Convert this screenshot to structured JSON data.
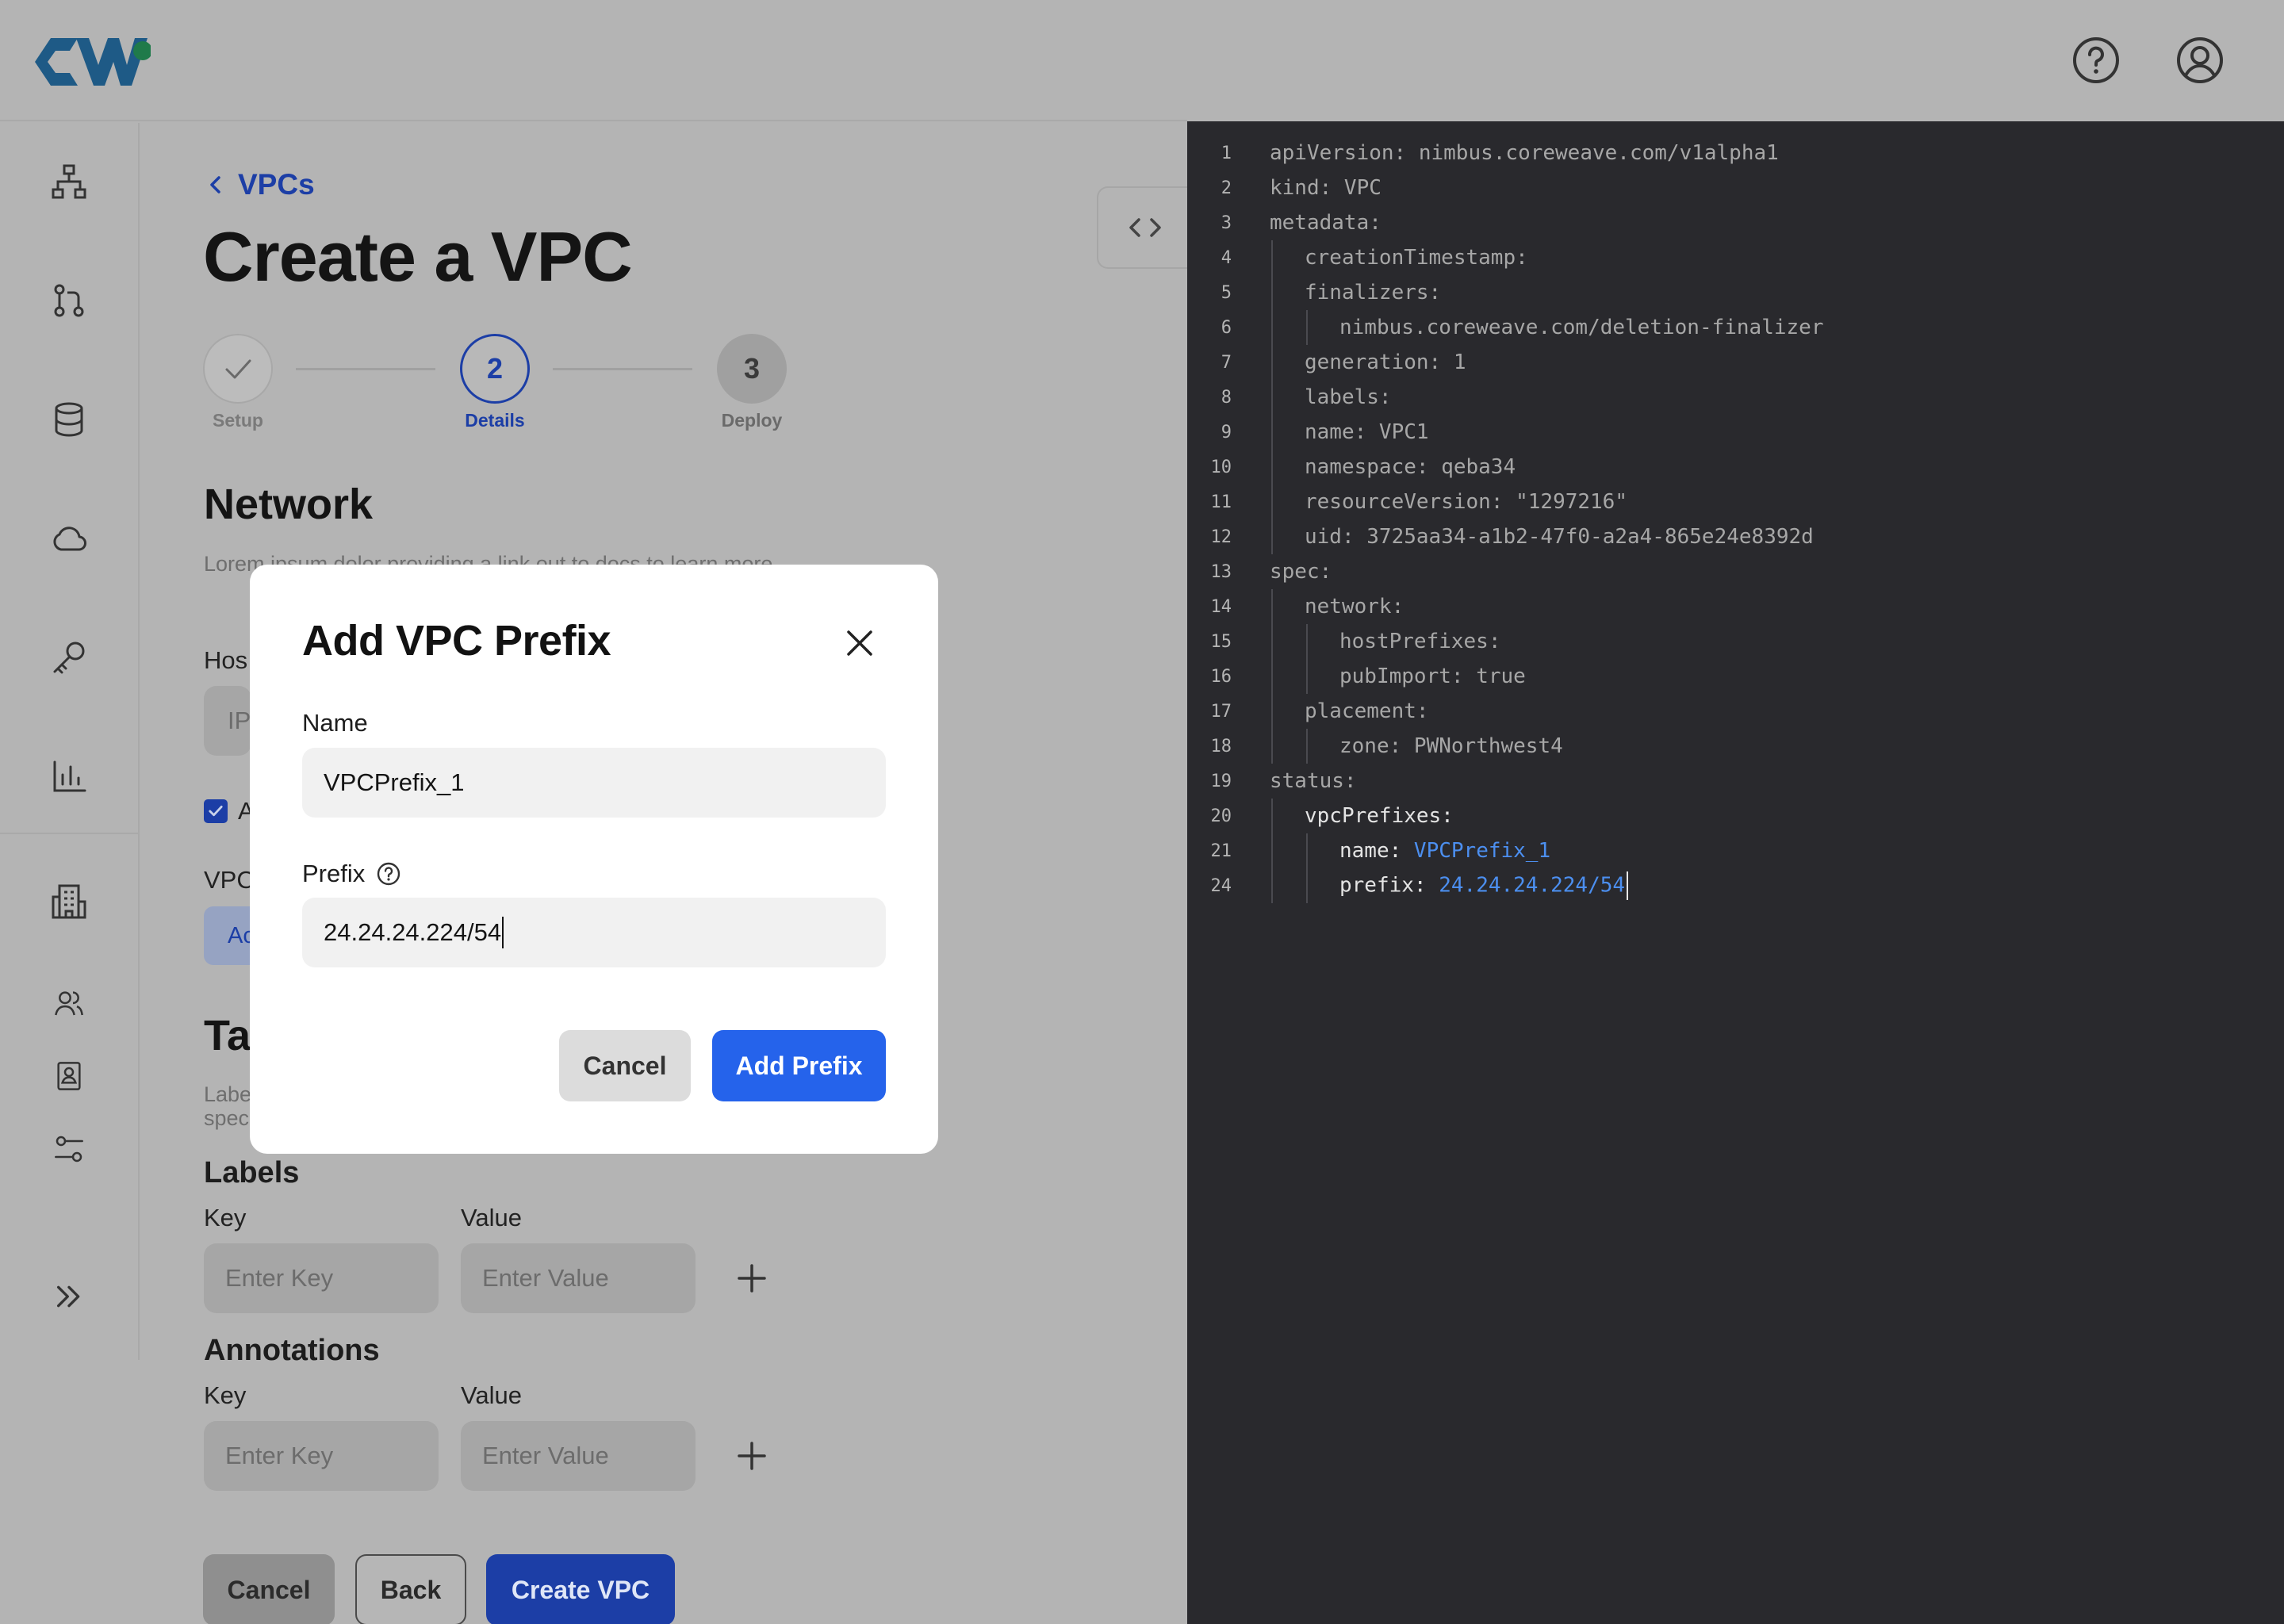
{
  "header": {
    "logo_alt": "CW",
    "help_icon": "help-circle-icon",
    "user_icon": "user-circle-icon"
  },
  "sidebar": {
    "items": [
      {
        "icon": "network-topology-icon"
      },
      {
        "icon": "git-pull-request-icon"
      },
      {
        "icon": "database-icon"
      },
      {
        "icon": "cloud-icon"
      },
      {
        "icon": "key-icon"
      },
      {
        "icon": "bar-chart-icon"
      },
      {
        "icon": "building-icon"
      },
      {
        "icon": "users-icon"
      },
      {
        "icon": "contact-book-icon"
      },
      {
        "icon": "settings-sliders-icon"
      },
      {
        "icon": "expand-chevrons-icon"
      }
    ]
  },
  "main": {
    "breadcrumb": "VPCs",
    "title": "Create a VPC",
    "steps": [
      {
        "number": "1",
        "label": "Setup",
        "state": "complete"
      },
      {
        "number": "2",
        "label": "Details",
        "state": "active"
      },
      {
        "number": "3",
        "label": "Deploy",
        "state": "pending"
      }
    ],
    "network": {
      "title": "Network",
      "description": "Lorem ipsum dolor providing a link out to docs to learn more",
      "host_label_partial": "Hos",
      "host_input_partial": "IP",
      "checkbox_label_partial": "A",
      "vpc_label_partial": "VPC",
      "vpc_chip_partial": "Ac"
    },
    "tags": {
      "title_partial": "Ta",
      "description_partial": "Labe spec",
      "labels": {
        "title": "Labels",
        "key_label": "Key",
        "value_label": "Value",
        "key_placeholder": "Enter Key",
        "value_placeholder": "Enter Value"
      },
      "annotations": {
        "title": "Annotations",
        "key_label": "Key",
        "value_label": "Value",
        "key_placeholder": "Enter Key",
        "value_placeholder": "Enter Value"
      }
    },
    "footer": {
      "cancel": "Cancel",
      "back": "Back",
      "create": "Create VPC"
    }
  },
  "modal": {
    "title": "Add VPC Prefix",
    "name_label": "Name",
    "name_value": "VPCPrefix_1",
    "prefix_label": "Prefix",
    "prefix_value": "24.24.24.224/54",
    "cancel": "Cancel",
    "submit": "Add Prefix"
  },
  "code": {
    "lines": [
      {
        "n": "1",
        "key": "apiVersion: ",
        "val": "nimbus.coreweave.com/v1alpha1",
        "indent": 0
      },
      {
        "n": "2",
        "key": "kind: ",
        "val": "VPC",
        "indent": 0
      },
      {
        "n": "3",
        "key": "metadata:",
        "val": "",
        "indent": 0
      },
      {
        "n": "4",
        "key": "creationTimestamp:",
        "val": "",
        "indent": 1
      },
      {
        "n": "5",
        "key": "finalizers:",
        "val": "",
        "indent": 1
      },
      {
        "n": "6",
        "key": "nimbus.coreweave.com/deletion-finalizer",
        "val": "",
        "indent": 2
      },
      {
        "n": "7",
        "key": "generation: ",
        "val": "1",
        "indent": 1
      },
      {
        "n": "8",
        "key": "labels:",
        "val": "",
        "indent": 1
      },
      {
        "n": "9",
        "key": "name: ",
        "val": "VPC1",
        "indent": 1
      },
      {
        "n": "10",
        "key": "namespace: ",
        "val": "qeba34",
        "indent": 1
      },
      {
        "n": "11",
        "key": "resourceVersion: ",
        "val": "\"1297216\"",
        "indent": 1
      },
      {
        "n": "12",
        "key": "uid: ",
        "val": "3725aa34-a1b2-47f0-a2a4-865e24e8392d",
        "indent": 1
      },
      {
        "n": "13",
        "key": "spec:",
        "val": "",
        "indent": 0
      },
      {
        "n": "14",
        "key": "network:",
        "val": "",
        "indent": 1
      },
      {
        "n": "15",
        "key": "hostPrefixes:",
        "val": "",
        "indent": 2
      },
      {
        "n": "16",
        "key": "pubImport: ",
        "val": "true",
        "indent": 2
      },
      {
        "n": "17",
        "key": "placement:",
        "val": "",
        "indent": 1
      },
      {
        "n": "18",
        "key": "zone: ",
        "val": "PWNorthwest4",
        "indent": 2
      },
      {
        "n": "19",
        "key": "status:",
        "val": "",
        "indent": 0
      },
      {
        "n": "20",
        "key": "vpcPrefixes:",
        "val": "",
        "indent": 1
      },
      {
        "n": "21",
        "key": "name: ",
        "val": "VPCPrefix_1",
        "indent": 2,
        "highlight": true
      },
      {
        "n": "24",
        "key": "prefix: ",
        "val": "24.24.24.224/54",
        "indent": 2,
        "highlight": true,
        "caret": true
      }
    ]
  },
  "colors": {
    "accent": "#2563eb",
    "dim_accent": "#1c3ea6",
    "code_bg": "#29292d",
    "code_highlight": "#4c8ff0"
  }
}
